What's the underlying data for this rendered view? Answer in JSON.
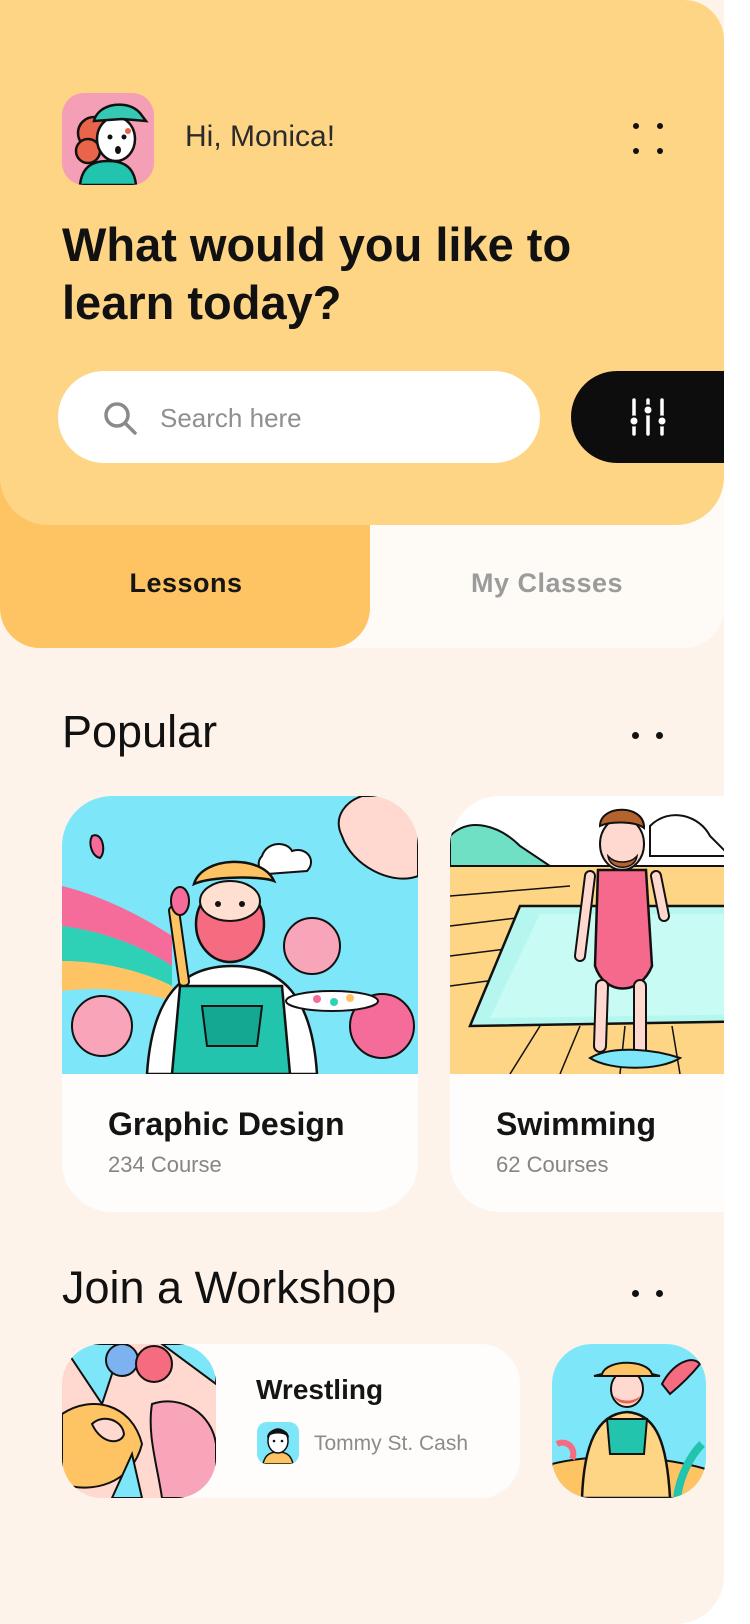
{
  "user": {
    "greeting": "Hi, Monica!",
    "avatar_icon": "user-avatar-illustration"
  },
  "header": {
    "headline": "What would you like to learn today?",
    "background": "#fed584"
  },
  "search": {
    "placeholder": "Search here",
    "value": ""
  },
  "filter": {
    "icon": "sliders-icon"
  },
  "tabs": [
    {
      "label": "Lessons",
      "active": true
    },
    {
      "label": "My Classes",
      "active": false
    }
  ],
  "popular": {
    "title": "Popular",
    "courses": [
      {
        "title": "Graphic Design",
        "subtitle": "234 Course"
      },
      {
        "title": "Swimming",
        "subtitle": "62 Courses"
      }
    ]
  },
  "workshop": {
    "title": "Join a Workshop",
    "items": [
      {
        "title": "Wrestling",
        "instructor": "Tommy St. Cash"
      }
    ]
  },
  "colors": {
    "accent": "#fec362",
    "dark": "#0d0d0d",
    "page_bg": "#fdf3ea"
  }
}
